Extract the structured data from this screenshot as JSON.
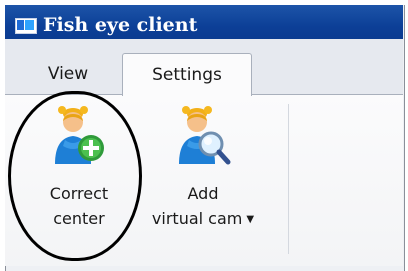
{
  "window": {
    "title": "Fish eye client"
  },
  "tabs": [
    {
      "label": "View",
      "active": false
    },
    {
      "label": "Settings",
      "active": true
    }
  ],
  "ribbon": {
    "buttons": [
      {
        "label_lines": [
          "Correct",
          "center"
        ],
        "icon": "person-add-icon",
        "has_dropdown": false
      },
      {
        "label_lines": [
          "Add",
          "virtual cam"
        ],
        "icon": "person-search-icon",
        "has_dropdown": true,
        "dropdown_glyph": "▼"
      }
    ]
  },
  "colors": {
    "titlebar": "#0c3f97",
    "annotation_circle": "#000000"
  }
}
